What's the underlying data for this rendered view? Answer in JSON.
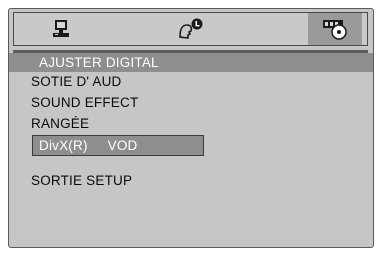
{
  "tabs": [
    {
      "name": "system",
      "icon": "monitor-icon",
      "active": false
    },
    {
      "name": "language",
      "icon": "speech-head-icon",
      "active": false
    },
    {
      "name": "audio",
      "icon": "speaker-disc-icon",
      "active": true
    }
  ],
  "menu": {
    "items": [
      {
        "label": "AJUSTER DIGITAL"
      },
      {
        "label": "SOTIE D' AUD"
      },
      {
        "label": "SOUND EFFECT"
      },
      {
        "label": "RANGÉE"
      },
      {
        "label_a": "DivX(R)",
        "label_b": "VOD"
      },
      {
        "label": "SORTIE SETUP"
      }
    ]
  },
  "colors": {
    "panel": "#c6c6c6",
    "highlight": "#8e8e8e",
    "selected_text": "#ffffff",
    "text": "#0a0a0a"
  }
}
